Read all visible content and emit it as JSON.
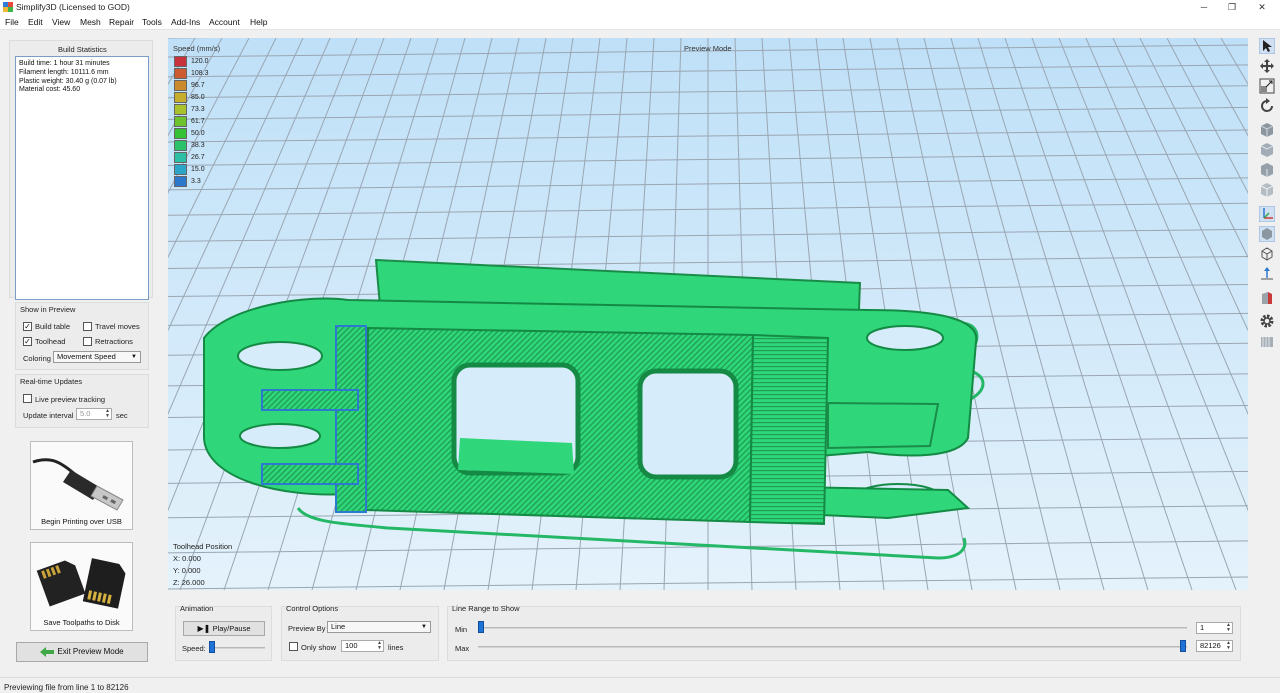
{
  "window": {
    "title": "Simplify3D (Licensed to GOD)",
    "minimize": "─",
    "maximize": "❐",
    "close": "✕"
  },
  "menu": [
    "File",
    "Edit",
    "View",
    "Mesh",
    "Repair",
    "Tools",
    "Add-Ins",
    "Account",
    "Help"
  ],
  "build_statistics": {
    "title": "Build Statistics",
    "lines": [
      "Build time: 1 hour 31 minutes",
      "Filament length: 10111.6 mm",
      "Plastic weight: 30.40 g (0.07 lb)",
      "Material cost: 45.60"
    ]
  },
  "show_in_preview": {
    "title": "Show in Preview",
    "build_table": {
      "label": "Build table",
      "checked": true
    },
    "travel_moves": {
      "label": "Travel moves",
      "checked": false
    },
    "toolhead": {
      "label": "Toolhead",
      "checked": true
    },
    "retractions": {
      "label": "Retractions",
      "checked": false
    },
    "coloring_label": "Coloring",
    "coloring_value": "Movement Speed"
  },
  "realtime": {
    "title": "Real-time Updates",
    "live_label": "Live preview tracking",
    "interval_label": "Update interval",
    "interval_value": "5.0",
    "interval_unit": "sec"
  },
  "usb_button": "Begin Printing over USB",
  "sd_button": "Save Toolpaths to Disk",
  "exit_button": "Exit Preview Mode",
  "viewport": {
    "title": "Preview Mode",
    "legend_title": "Speed (mm/s)",
    "legend": [
      {
        "value": "120.0",
        "color": "#c8323c"
      },
      {
        "value": "108.3",
        "color": "#cc5c30"
      },
      {
        "value": "96.7",
        "color": "#cc8a2e"
      },
      {
        "value": "85.0",
        "color": "#c6ae2c"
      },
      {
        "value": "73.3",
        "color": "#a8c22c"
      },
      {
        "value": "61.7",
        "color": "#6cc22c"
      },
      {
        "value": "50.0",
        "color": "#34c234"
      },
      {
        "value": "38.3",
        "color": "#2cc26a"
      },
      {
        "value": "26.7",
        "color": "#2cbfa4"
      },
      {
        "value": "15.0",
        "color": "#2ca6c8"
      },
      {
        "value": "3.3",
        "color": "#2c78cc"
      }
    ],
    "toolhead_title": "Toolhead Position",
    "x": "X: 0.000",
    "y": "Y: 0.000",
    "z": "Z: 26.000"
  },
  "animation": {
    "title": "Animation",
    "play_label": "Play/Pause",
    "speed_label": "Speed:"
  },
  "control_options": {
    "title": "Control Options",
    "preview_by_label": "Preview By",
    "preview_by_value": "Line",
    "only_show_label": "Only show",
    "only_show_value": "100",
    "lines_label": "lines"
  },
  "line_range": {
    "title": "Line Range to Show",
    "min_label": "Min",
    "min_value": "1",
    "max_label": "Max",
    "max_value": "82126"
  },
  "status": "Previewing file from line 1 to 82126",
  "toolbar_icons": [
    "select-icon",
    "move-icon",
    "scale-icon",
    "rotate-icon",
    "view-default-icon",
    "view-front-icon",
    "view-top-icon",
    "view-side-icon",
    "axes-icon",
    "solid-view-icon",
    "wireframe-view-icon",
    "z-axis-icon",
    "cross-section-icon",
    "settings-gear-icon",
    "print-bed-icon"
  ]
}
